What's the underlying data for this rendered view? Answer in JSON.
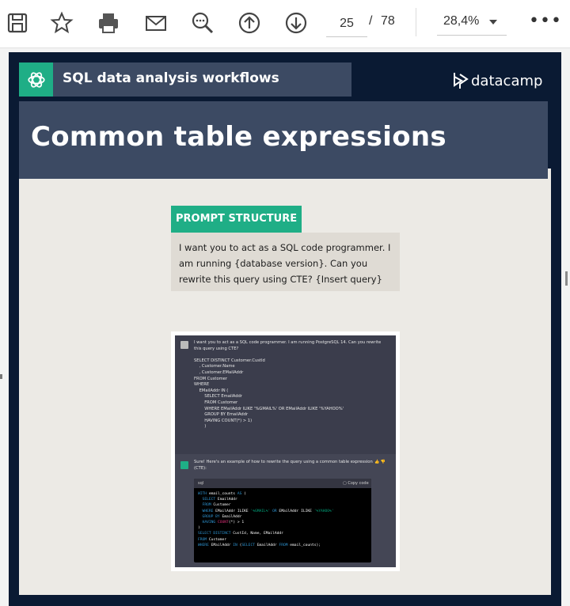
{
  "toolbar": {
    "icons": [
      "save-icon",
      "bookmark-star-icon",
      "print-icon",
      "email-icon",
      "zoom-out-icon",
      "previous-page-icon",
      "next-page-icon"
    ],
    "current_page": "25",
    "page_separator": "/",
    "total_pages": "78",
    "zoom_level": "28,4%",
    "more_label": "•••"
  },
  "slide": {
    "brand_title": "SQL data analysis workflows",
    "logo_text": "datacamp",
    "title": "Common table expressions",
    "prompt_label": "PROMPT STRUCTURE",
    "prompt_text": "I want you to act as a SQL code programmer. I am running {database version}. Can you rewrite this query using CTE? {Insert query}",
    "colors": {
      "navy": "#0a1a33",
      "panel": "#3c4a63",
      "green": "#1fae86",
      "background": "#eceae5"
    }
  },
  "chat": {
    "user_message": "I want you to act as a SQL code programmer. I am running PostgreSQL 14. Can you rewrite\nthis query using CTE?\n\nSELECT DISTINCT Customer.CustId\n    , Customer.Name\n    , Customer.EMailAddr\nFROM Customer\nWHERE\n    EMailAddr IN (\n        SELECT EmailAddr\n        FROM Customer\n        WHERE EMailAddr ILIKE '%GMAIL%' OR EMailAddr ILIKE '%YAHOO%'\n        GROUP BY EmailAddr\n        HAVING COUNT(*) > 1)\n        )",
    "assistant_message": "Sure! Here's an example of how to rewrite the query using a common table expression (CTE):",
    "code_language": "sql",
    "copy_label": "Copy code"
  }
}
